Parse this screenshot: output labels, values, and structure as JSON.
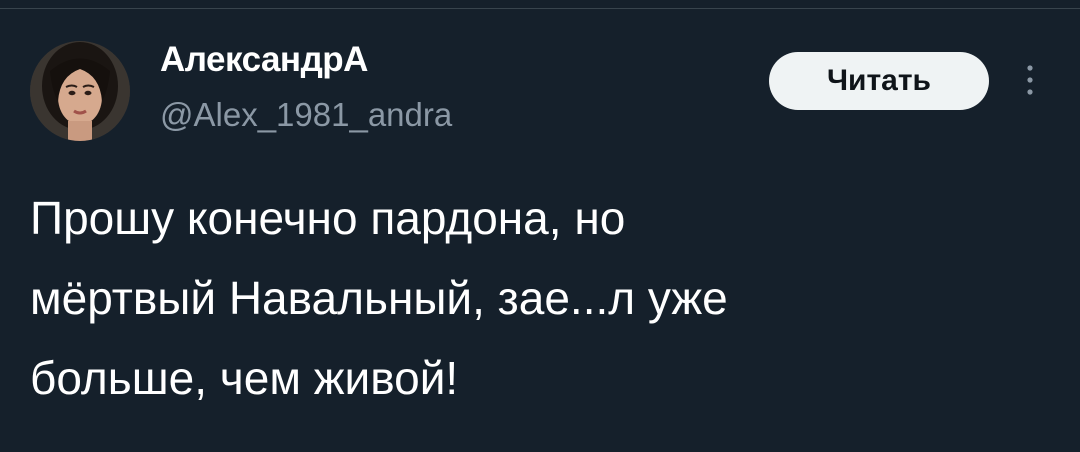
{
  "author": {
    "display_name": "АлександрА",
    "handle": "@Alex_1981_andra",
    "avatar_icon": "user-avatar"
  },
  "actions": {
    "follow_label": "Читать",
    "more_icon": "more-vertical-icon"
  },
  "tweet": {
    "lines": [
      "Прошу конечно пардона, но",
      "мёртвый Навальный, зае...л уже",
      "больше, чем живой!"
    ]
  },
  "colors": {
    "background": "#15202b",
    "text_primary": "#ffffff",
    "text_secondary": "#8b98a5",
    "button_bg": "#eff3f4",
    "button_text": "#0f1419"
  }
}
